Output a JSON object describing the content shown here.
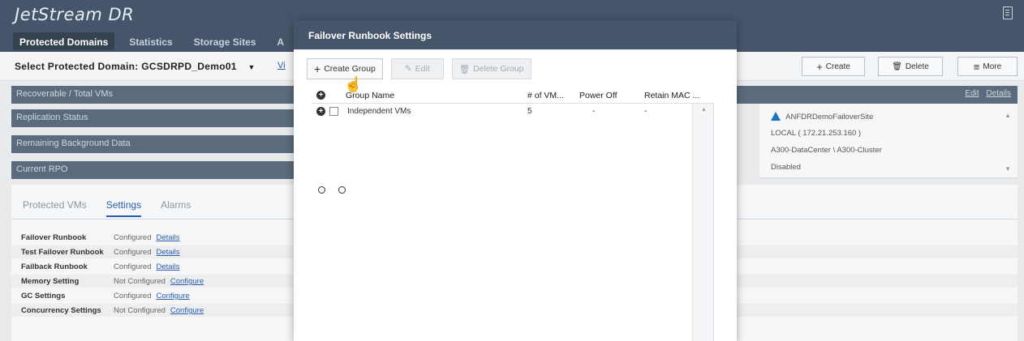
{
  "app": {
    "logo": "JetStream DR",
    "nav": [
      {
        "label": "Protected Domains",
        "active": true
      },
      {
        "label": "Statistics",
        "active": false
      },
      {
        "label": "Storage Sites",
        "active": false
      },
      {
        "label": "A",
        "active": false
      }
    ]
  },
  "toolbar": {
    "domain_label": "Select Protected Domain:",
    "domain_value": "GCSDRPD_Demo01",
    "domain_link": "Vi",
    "create_label": "Create",
    "delete_label": "Delete",
    "more_label": "More"
  },
  "bars": {
    "recoverable": "Recoverable / Total VMs",
    "replication": "Replication Status",
    "remaining": "Remaining Background Data",
    "rpo": "Current RPO",
    "edit_link": "Edit",
    "details_link": "Details"
  },
  "site_panel": {
    "site_name": "ANFDRDemoFailoverSite",
    "local": "LOCAL ( 172.21.253.160 )",
    "cluster": "A300-DataCenter \\ A300-Cluster",
    "status": "Disabled"
  },
  "lower": {
    "tabs": [
      "Protected VMs",
      "Settings",
      "Alarms"
    ],
    "settings": [
      {
        "label": "Failover Runbook",
        "value": "Configured",
        "link": "Details"
      },
      {
        "label": "Test Failover Runbook",
        "value": "Configured",
        "link": "Details"
      },
      {
        "label": "Failback Runbook",
        "value": "Configured",
        "link": "Details"
      },
      {
        "label": "Memory Setting",
        "value": "Not Configured",
        "link": "Configure"
      },
      {
        "label": "GC Settings",
        "value": "Configured",
        "link": "Configure"
      },
      {
        "label": "Concurrency Settings",
        "value": "Not Configured",
        "link": "Configure"
      }
    ]
  },
  "modal": {
    "title": "Failover Runbook Settings",
    "create_group": "Create Group",
    "edit": "Edit",
    "delete_group": "Delete Group",
    "columns": {
      "group_name": "Group Name",
      "num_vms": "# of VM...",
      "power_off": "Power Off",
      "retain_mac": "Retain MAC ..."
    },
    "rows": [
      {
        "group_name": "Independent VMs",
        "num_vms": "5",
        "power_off": "-",
        "retain_mac": "-"
      }
    ]
  },
  "colors": {
    "header_bg": "#46566a",
    "bar_bg": "#5a6b7d",
    "link": "#2a5db0",
    "azure": "#1a73c9"
  }
}
